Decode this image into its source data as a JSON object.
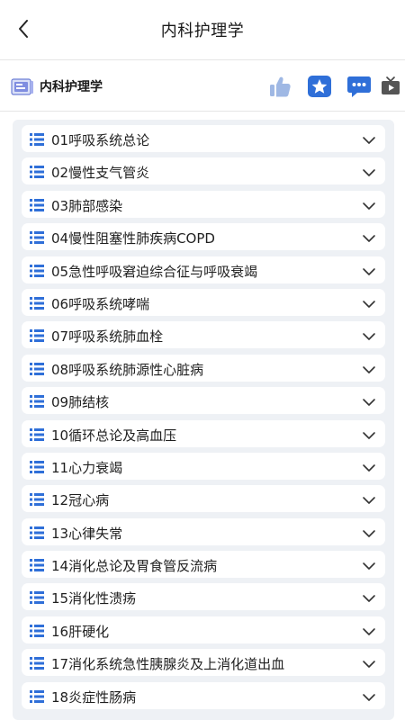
{
  "nav": {
    "title": "内科护理学"
  },
  "course": {
    "name": "内科护理学"
  },
  "colors": {
    "accent": "#2f6fd8",
    "like": "#9fb8e4",
    "panel": "#eef1f5"
  },
  "icons": {
    "back": "chevron-left-icon",
    "course": "book-icon",
    "like": "thumbs-up-icon",
    "favorite": "star-icon",
    "comment": "chat-bubble-icon",
    "video": "tv-icon",
    "item": "list-icon",
    "expand": "chevron-down-icon"
  },
  "chapters": [
    "01呼吸系统总论",
    "02慢性支气管炎",
    "03肺部感染",
    "04慢性阻塞性肺疾病COPD",
    "05急性呼吸窘迫综合征与呼吸衰竭",
    "06呼吸系统哮喘",
    "07呼吸系统肺血栓",
    "08呼吸系统肺源性心脏病",
    "09肺结核",
    "10循环总论及高血压",
    "11心力衰竭",
    "12冠心病",
    "13心律失常",
    "14消化总论及胃食管反流病",
    "15消化性溃疡",
    "16肝硬化",
    "17消化系统急性胰腺炎及上消化道出血",
    "18炎症性肠病"
  ]
}
